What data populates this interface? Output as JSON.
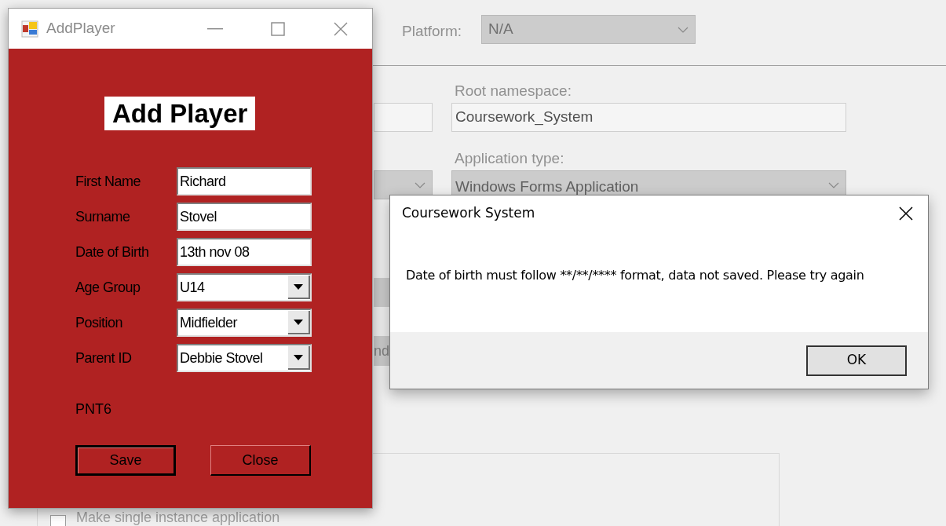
{
  "background": {
    "platform": {
      "label": "Platform:",
      "value": "N/A"
    },
    "root_namespace": {
      "label": "Root namespace:",
      "value": "Coursework_System"
    },
    "application_type": {
      "label": "Application type:",
      "value": "Windows Forms Application"
    },
    "partial_button": {
      "label": "nd"
    },
    "checkbox": {
      "label": "Make single instance application",
      "checked": false
    }
  },
  "add_player_window": {
    "title": "AddPlayer",
    "heading": "Add Player",
    "fields": [
      {
        "kind": "text",
        "label": "First Name",
        "value": "Richard"
      },
      {
        "kind": "text",
        "label": "Surname",
        "value": "Stovel"
      },
      {
        "kind": "text",
        "label": "Date of Birth",
        "value": "13th nov 08"
      },
      {
        "kind": "dropdown",
        "label": "Age Group",
        "value": "U14"
      },
      {
        "kind": "dropdown",
        "label": "Position",
        "value": "Midfielder"
      },
      {
        "kind": "dropdown",
        "label": "Parent ID",
        "value": "Debbie Stovel"
      }
    ],
    "id_text": "PNT6",
    "buttons": [
      {
        "label": "Save",
        "focused": true
      },
      {
        "label": "Close",
        "focused": false
      }
    ]
  },
  "message_box": {
    "title": "Coursework System",
    "message": "Date of birth must follow **/**/**** format, data not saved. Please try again",
    "buttons": [
      "OK"
    ]
  }
}
